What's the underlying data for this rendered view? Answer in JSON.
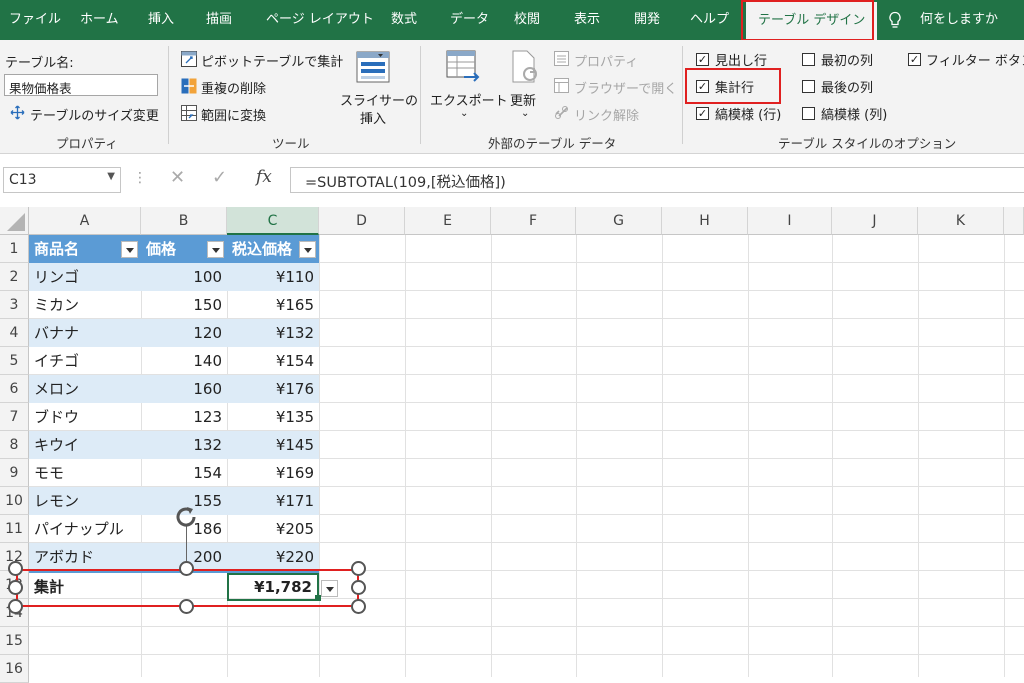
{
  "tabs": [
    "ファイル",
    "ホーム",
    "挿入",
    "描画",
    "ページ レイアウト",
    "数式",
    "データ",
    "校閲",
    "表示",
    "開発",
    "ヘルプ",
    "テーブル デザイン",
    "何をしますか"
  ],
  "ribbon": {
    "properties": {
      "table_name_label": "テーブル名:",
      "table_name_value": "果物価格表",
      "resize": "テーブルのサイズ変更",
      "group_label": "プロパティ"
    },
    "tools": {
      "pivot": "ピボットテーブルで集計",
      "remove_dup": "重複の削除",
      "convert": "範囲に変換",
      "slicer_line1": "スライサーの",
      "slicer_line2": "挿入",
      "group_label": "ツール"
    },
    "external": {
      "export": "エクスポート",
      "refresh": "更新",
      "properties": "プロパティ",
      "open_browser": "ブラウザーで開く",
      "unlink": "リンク解除",
      "group_label": "外部のテーブル データ"
    },
    "style_options": {
      "header_row": "見出し行",
      "total_row": "集計行",
      "banded_rows": "縞模様 (行)",
      "first_col": "最初の列",
      "last_col": "最後の列",
      "banded_cols": "縞模様 (列)",
      "filter_button": "フィルター ボタン",
      "group_label": "テーブル スタイルのオプション",
      "checked": [
        "header_row",
        "total_row",
        "banded_rows",
        "filter_button"
      ]
    }
  },
  "formula_bar": {
    "cell_ref": "C13",
    "formula": "=SUBTOTAL(109,[税込価格])",
    "fx": "fx"
  },
  "columns": [
    "A",
    "B",
    "C",
    "D",
    "E",
    "F",
    "G",
    "H",
    "I",
    "J",
    "K"
  ],
  "rows": [
    "1",
    "2",
    "3",
    "4",
    "5",
    "6",
    "7",
    "8",
    "9",
    "10",
    "11",
    "12",
    "13",
    "14",
    "15",
    "16"
  ],
  "table": {
    "headers": [
      "商品名",
      "価格",
      "税込価格"
    ],
    "data": [
      [
        "リンゴ",
        "100",
        "¥110"
      ],
      [
        "ミカン",
        "150",
        "¥165"
      ],
      [
        "バナナ",
        "120",
        "¥132"
      ],
      [
        "イチゴ",
        "140",
        "¥154"
      ],
      [
        "メロン",
        "160",
        "¥176"
      ],
      [
        "ブドウ",
        "123",
        "¥135"
      ],
      [
        "キウイ",
        "132",
        "¥145"
      ],
      [
        "モモ",
        "154",
        "¥169"
      ],
      [
        "レモン",
        "155",
        "¥171"
      ],
      [
        "パイナップル",
        "186",
        "¥205"
      ],
      [
        "アボカド",
        "200",
        "¥220"
      ]
    ],
    "total_label": "集計",
    "total_value": "¥1,782"
  },
  "colors": {
    "accent": "#217346",
    "table_header": "#5b9bd5",
    "band": "#ddebf7",
    "highlight": "#e02020"
  }
}
